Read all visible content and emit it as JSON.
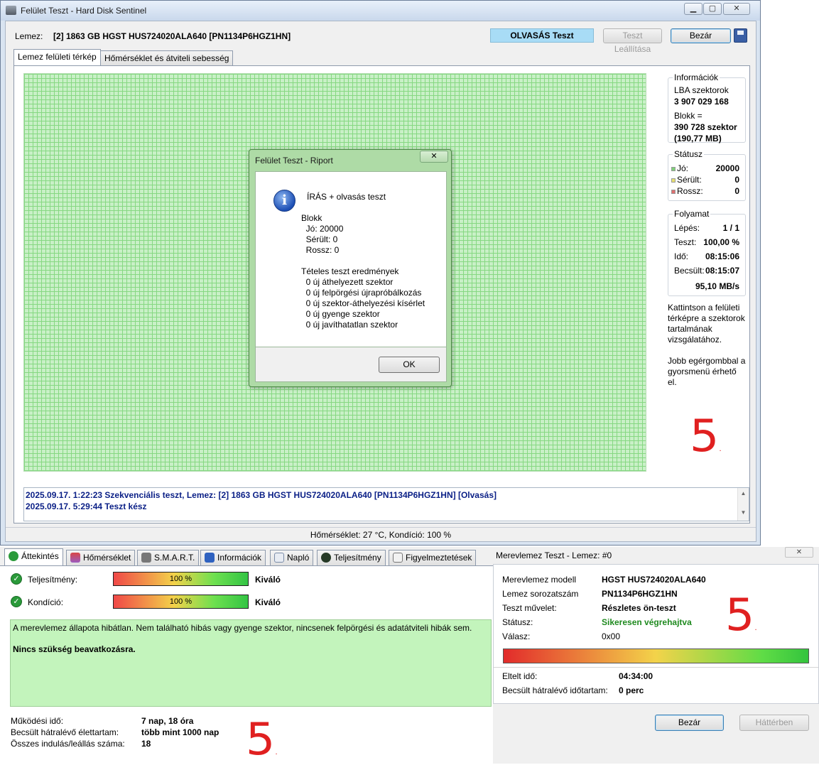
{
  "window": {
    "title": "Felület Teszt - Hard Disk Sentinel",
    "lemez_label": "Lemez:",
    "lemez_value": "[2] 1863 GB  HGST HUS724020ALA640 [PN1134P6HGZ1HN]",
    "status_button": "OLVASÁS Teszt",
    "stop_button": "Teszt Leállítása",
    "close_button": "Bezár",
    "tabs": [
      "Lemez felületi térkép",
      "Hőmérséklet és átviteli sebesség"
    ]
  },
  "info": {
    "group_title": "Információk",
    "lba_label": "LBA szektorok",
    "lba_value": "3 907 029 168",
    "block_label": "Blokk =",
    "block_value1": "390 728 szektor",
    "block_value2": "(190,77 MB)"
  },
  "status_group": {
    "title": "Státusz",
    "good_label": "Jó:",
    "good_value": "20000",
    "damaged_label": "Sérült:",
    "damaged_value": "0",
    "bad_label": "Rossz:",
    "bad_value": "0",
    "colors": {
      "good": "#7ed07a",
      "damaged": "#e8e070",
      "bad": "#e07070"
    }
  },
  "progress_group": {
    "title": "Folyamat",
    "step_label": "Lépés:",
    "step_value": "1 / 1",
    "test_label": "Teszt:",
    "test_value": "100,00 %",
    "time_label": "Idő:",
    "time_value": "08:15:06",
    "est_label": "Becsült:",
    "est_value": "08:15:07",
    "speed": "95,10 MB/s"
  },
  "hint1": "Kattintson a felületi térképre a szektorok tartalmának vizsgálatához.",
  "hint2": "Jobb egérgombbal a gyorsmenü érhető el.",
  "log": [
    "2025.09.17.  1:22:23   Szekvenciális teszt, Lemez: [2] 1863 GB  HGST HUS724020ALA640 [PN1134P6HGZ1HN] [Olvasás]",
    "2025.09.17.  5:29:44   Teszt kész"
  ],
  "statusbar": "Hőmérséklet: 27  °C,  Kondíció: 100 %",
  "report": {
    "title": "Felület Teszt - Riport",
    "lines": [
      "ÍRÁS + olvasás teszt",
      "",
      "Blokk",
      "  Jó: 20000",
      "  Sérült: 0",
      "  Rossz: 0",
      "",
      "Tételes teszt eredmények",
      "  0 új áthelyezett szektor",
      "  0 új felpörgési újrapróbálkozás",
      "  0 új szektor-áthelyezési kísérlet",
      "  0 új gyenge szektor",
      "  0 új javíthatatlan szektor"
    ],
    "ok": "OK"
  },
  "overview": {
    "tabs": [
      "Áttekintés",
      "Hőmérséklet",
      "S.M.A.R.T.",
      "Információk",
      "Napló",
      "Teljesítmény",
      "Figyelmeztetések"
    ],
    "performance_label": "Teljesítmény:",
    "performance_value": "100 %",
    "performance_rating": "Kiváló",
    "performance_percent": 100,
    "condition_label": "Kondíció:",
    "condition_value": "100 %",
    "condition_rating": "Kiváló",
    "condition_percent": 100,
    "message": "A merevlemez állapota hibátlan. Nem található hibás vagy gyenge szektor, nincsenek felpörgési és adatátviteli hibák sem.",
    "action": "Nincs szükség beavatkozásra.",
    "uptime_label": "Működési idő:",
    "uptime_value": "7 nap, 18 óra",
    "life_label": "Becsült hátralévő élettartam:",
    "life_value": "több mint 1000 nap",
    "starts_label": "Összes indulás/leállás száma:",
    "starts_value": "18"
  },
  "hdd_test": {
    "title": "Merevlemez Teszt - Lemez: #0",
    "model_label": "Merevlemez modell",
    "model_value": "HGST HUS724020ALA640",
    "serial_label": "Lemez sorozatszám",
    "serial_value": "PN1134P6HGZ1HN",
    "op_label": "Teszt művelet:",
    "op_value": "Részletes ön-teszt",
    "status_label": "Státusz:",
    "status_value": "Sikeresen végrehajtva",
    "resp_label": "Válasz:",
    "resp_value": "0x00",
    "progress_percent": 100,
    "elapsed_label": "Eltelt idő:",
    "elapsed_value": "04:34:00",
    "remaining_label": "Becsült hátralévő időtartam:",
    "remaining_value": "0 perc",
    "close": "Bezár",
    "background": "Háttérben"
  },
  "handwritten": [
    "5",
    "5",
    "5"
  ]
}
